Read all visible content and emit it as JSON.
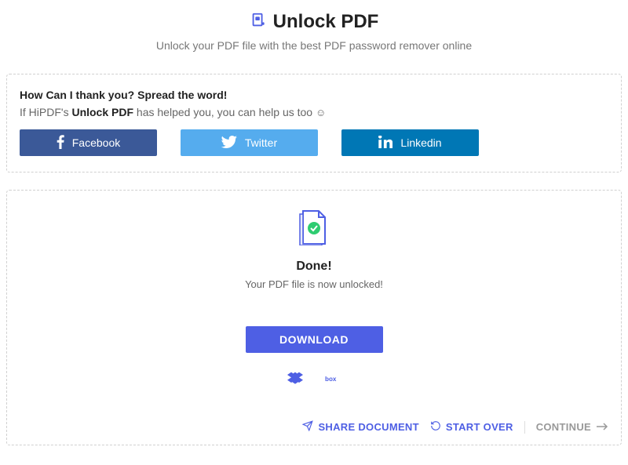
{
  "header": {
    "title": "Unlock PDF",
    "subtitle": "Unlock your PDF file with the best PDF password remover online"
  },
  "share": {
    "heading": "How Can I thank you? Spread the word!",
    "sub_prefix": "If HiPDF's ",
    "sub_strong": "Unlock PDF",
    "sub_suffix": " has helped you, you can help us too ",
    "facebook": "Facebook",
    "twitter": "Twitter",
    "linkedin": "Linkedin"
  },
  "result": {
    "done_label": "Done!",
    "done_sub": "Your PDF file is now unlocked!",
    "download": "DOWNLOAD",
    "share_doc": "SHARE DOCUMENT",
    "start_over": "START OVER",
    "continue": "CONTINUE"
  }
}
